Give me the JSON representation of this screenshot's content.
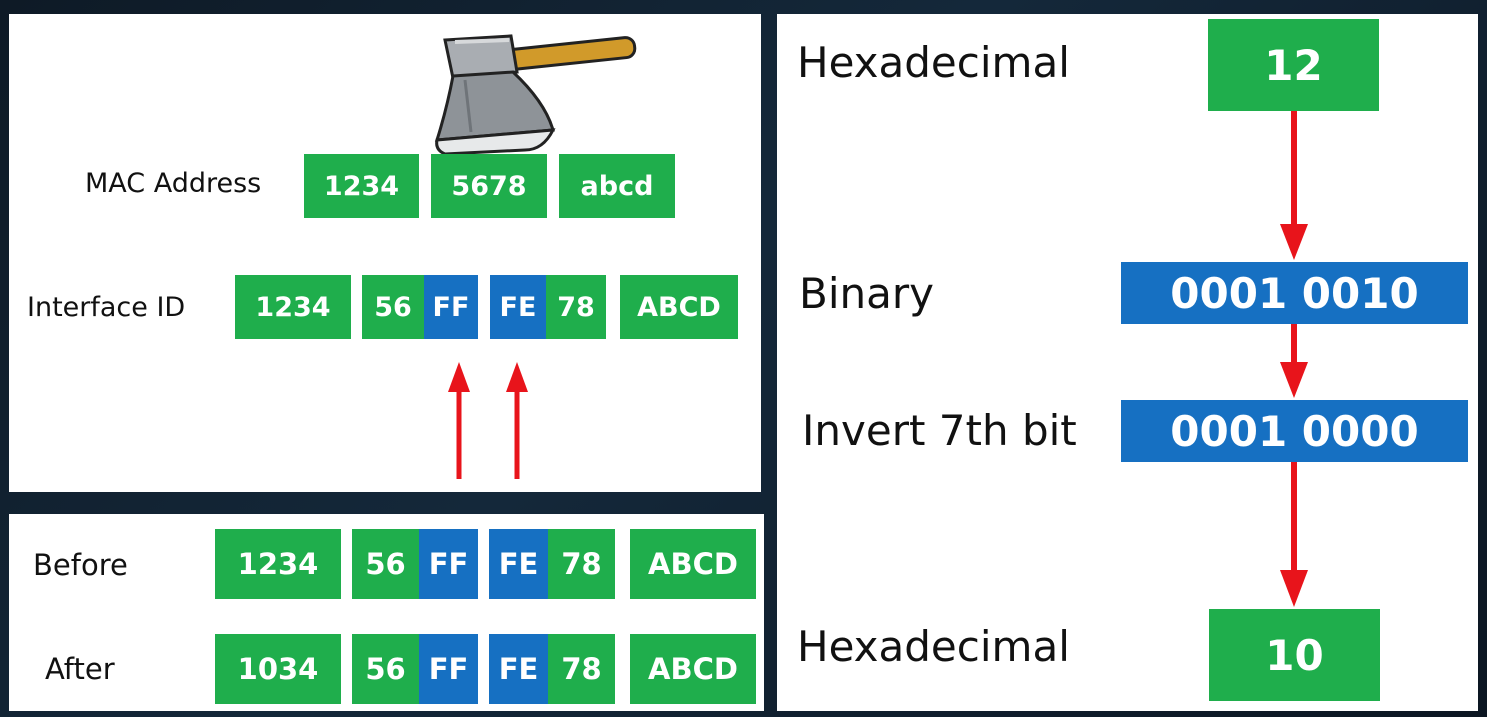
{
  "top_panel": {
    "mac_label": "MAC Address",
    "mac": [
      "1234",
      "5678",
      "abcd"
    ],
    "iid_label": "Interface ID",
    "iid": {
      "g1": "1234",
      "g2a": "56",
      "g2b": "FF",
      "g3a": "FE",
      "g3b": "78",
      "g4": "ABCD"
    },
    "icon": "axe-icon"
  },
  "bottom_panel": {
    "before_label": "Before",
    "before": {
      "g1": "1234",
      "g2a": "56",
      "g2b": "FF",
      "g3a": "FE",
      "g3b": "78",
      "g4": "ABCD"
    },
    "after_label": "After",
    "after": {
      "g1": "1034",
      "g2a": "56",
      "g2b": "FF",
      "g3a": "FE",
      "g3b": "78",
      "g4": "ABCD"
    }
  },
  "right_panel": {
    "hex_label_1": "Hexadecimal",
    "hex_value_1": "12",
    "binary_label": "Binary",
    "binary_value": "0001 0010",
    "invert_label": "Invert 7th bit",
    "invert_value": "0001 0000",
    "hex_label_2": "Hexadecimal",
    "hex_value_2": "10"
  },
  "colors": {
    "green": "#1fae4c",
    "blue": "#1670c2",
    "arrow_red": "#e8141b"
  }
}
